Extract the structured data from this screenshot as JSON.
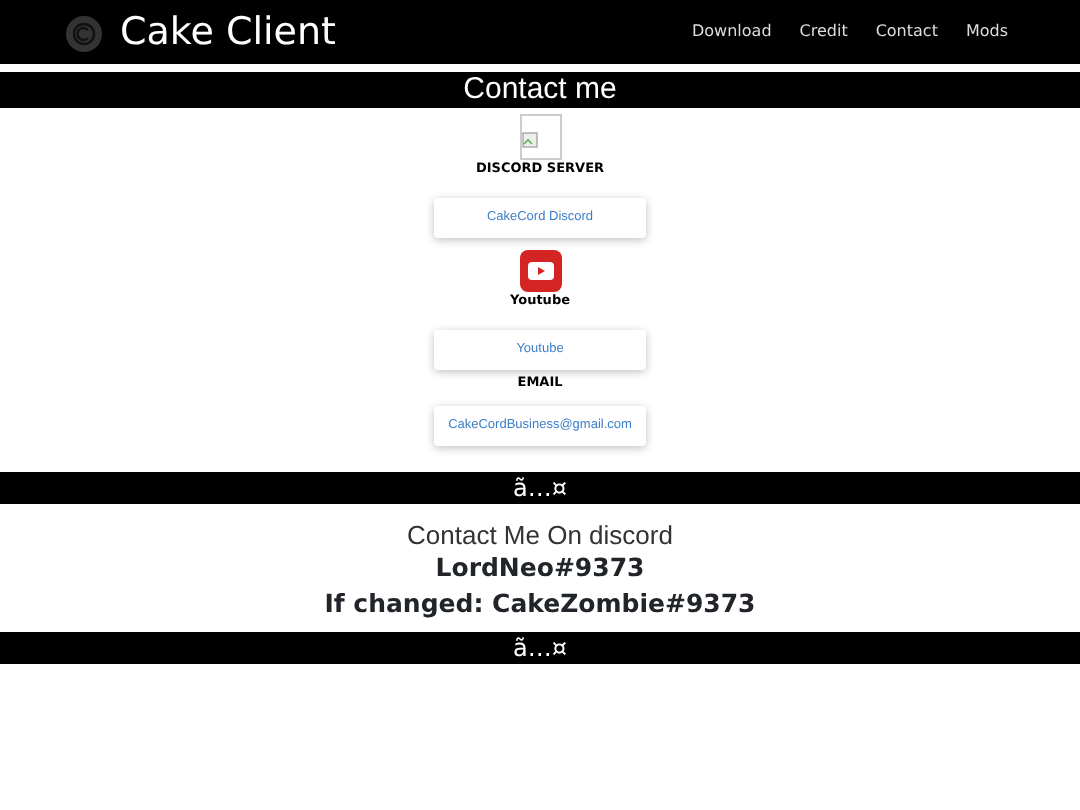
{
  "navbar": {
    "brand": "Cake Client",
    "links": [
      "Download",
      "Credit",
      "Contact",
      "Mods"
    ]
  },
  "heading": "Contact me",
  "contacts": [
    {
      "kind": "broken-image",
      "label": "DISCORD SERVER",
      "button": "CakeCord Discord"
    },
    {
      "kind": "youtube",
      "label": "Youtube",
      "button": "Youtube"
    },
    {
      "kind": "none",
      "label": "EMAIL",
      "button": "CakeCordBusiness@gmail.com"
    }
  ],
  "divider_1": "ã…¤",
  "discord": {
    "intro": "Contact Me On discord",
    "tag": "LordNeo#9373",
    "alt": "If changed: CakeZombie#9373"
  },
  "divider_2": "ã…¤"
}
